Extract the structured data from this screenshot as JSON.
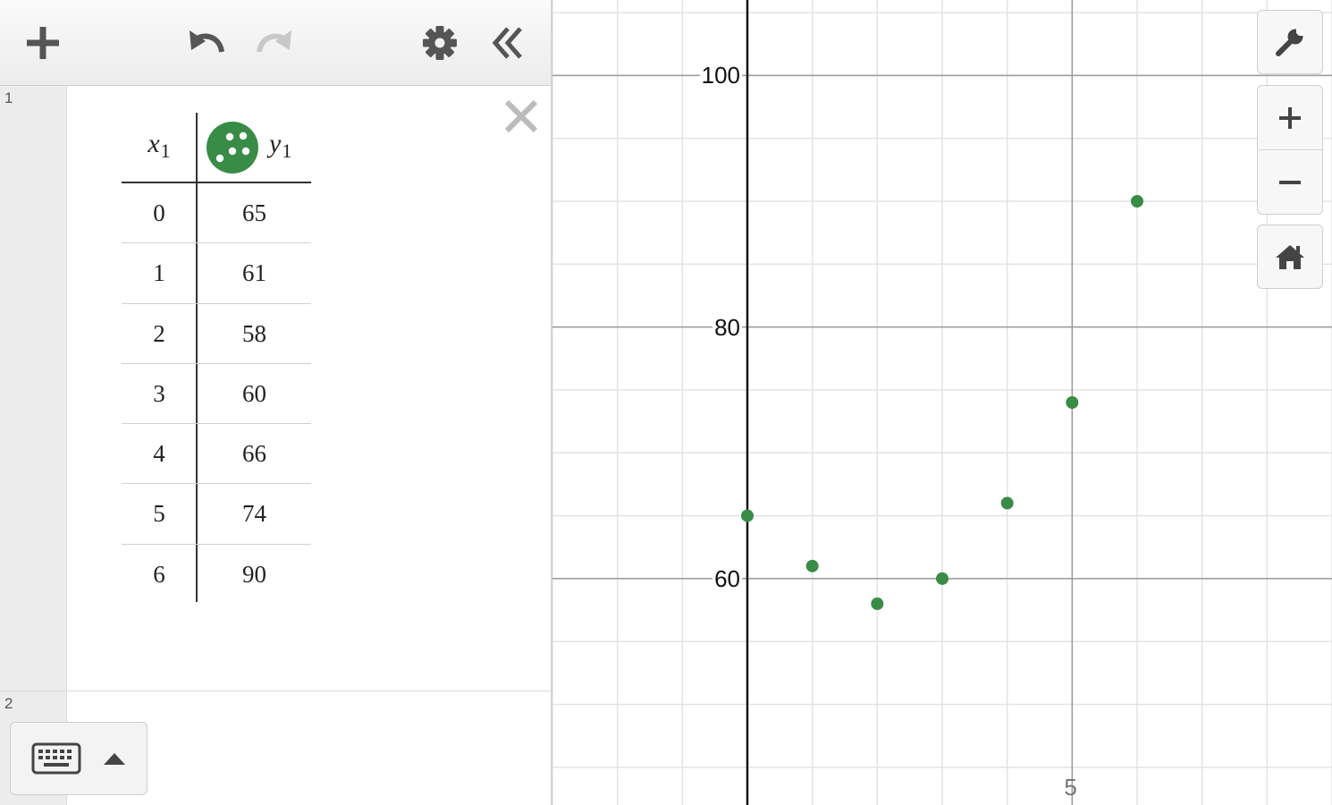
{
  "expression_list": {
    "expressions": [
      {
        "index": "1",
        "type": "table",
        "columns": [
          {
            "var": "x",
            "sub": "1"
          },
          {
            "var": "y",
            "sub": "1"
          }
        ],
        "series_color": "#388c46",
        "rows": [
          {
            "x": "0",
            "y": "65"
          },
          {
            "x": "1",
            "y": "61"
          },
          {
            "x": "2",
            "y": "58"
          },
          {
            "x": "3",
            "y": "60"
          },
          {
            "x": "4",
            "y": "66"
          },
          {
            "x": "5",
            "y": "74"
          },
          {
            "x": "6",
            "y": "90"
          }
        ]
      },
      {
        "index": "2",
        "type": "empty"
      }
    ]
  },
  "toolbar": {
    "icons": [
      "plus-icon",
      "undo-icon",
      "redo-icon",
      "gear-icon",
      "collapse-icon"
    ]
  },
  "graph_controls": {
    "icons": [
      "wrench-icon",
      "zoom-in-icon",
      "zoom-out-icon",
      "home-icon"
    ]
  },
  "keyboard": {
    "icons": [
      "keyboard-icon",
      "caret-up-icon"
    ]
  },
  "chart_data": {
    "type": "scatter",
    "x": [
      0,
      1,
      2,
      3,
      4,
      5,
      6
    ],
    "y": [
      65,
      61,
      58,
      60,
      66,
      74,
      90
    ],
    "xlim": [
      -3,
      9
    ],
    "ylim": [
      42,
      106
    ],
    "x_ticks": [
      5
    ],
    "y_ticks": [
      60,
      80,
      100
    ],
    "x_tick_labels": [
      "5"
    ],
    "y_tick_labels": [
      "60",
      "80",
      "100"
    ],
    "minor_grid_x": 1,
    "minor_grid_y": 5,
    "grid": true,
    "color": "#388c46"
  }
}
